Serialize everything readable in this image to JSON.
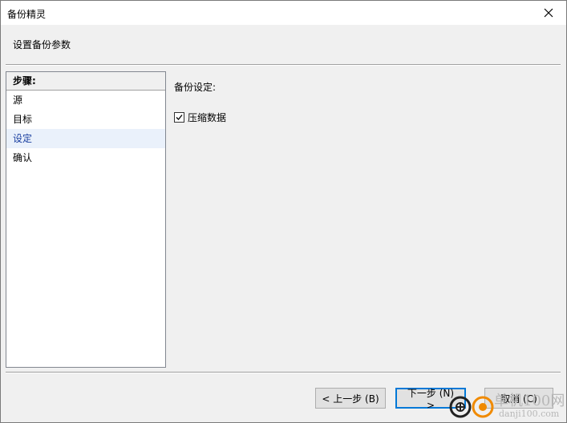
{
  "window": {
    "title": "备份精灵"
  },
  "header": {
    "text": "设置备份参数"
  },
  "steps": {
    "title": "步骤:",
    "items": [
      {
        "label": "源",
        "active": false
      },
      {
        "label": "目标",
        "active": false
      },
      {
        "label": "设定",
        "active": true
      },
      {
        "label": "确认",
        "active": false
      }
    ]
  },
  "settings": {
    "label": "备份设定:",
    "compress": {
      "label": "压缩数据",
      "checked": true
    }
  },
  "buttons": {
    "back": "< 上一步 (B)",
    "next": "下一步 (N) >",
    "cancel": "取消 (C)"
  },
  "watermark": {
    "text": "单机100网",
    "sub": "danji100.com"
  },
  "colors": {
    "accent": "#0078d7",
    "active_step_bg": "#eaf1fb"
  }
}
